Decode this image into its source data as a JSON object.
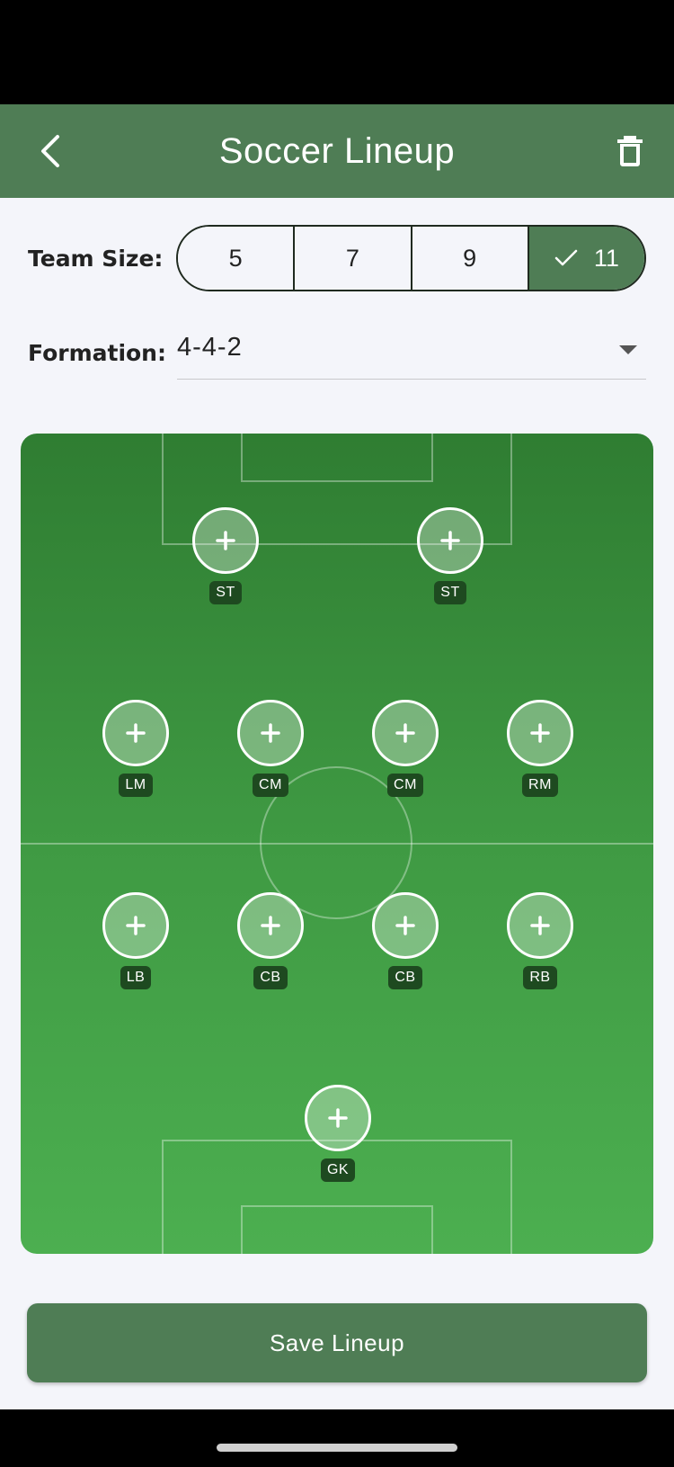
{
  "app": {
    "title": "Soccer Lineup"
  },
  "team_size": {
    "label": "Team Size:",
    "options": [
      "5",
      "7",
      "9",
      "11"
    ],
    "selected": "11"
  },
  "formation": {
    "label": "Formation:",
    "value": "4-4-2"
  },
  "players": [
    {
      "position": "ST"
    },
    {
      "position": "ST"
    },
    {
      "position": "LM"
    },
    {
      "position": "CM"
    },
    {
      "position": "CM"
    },
    {
      "position": "RM"
    },
    {
      "position": "LB"
    },
    {
      "position": "CB"
    },
    {
      "position": "CB"
    },
    {
      "position": "RB"
    },
    {
      "position": "GK"
    }
  ],
  "add_symbol": "+",
  "save_label": "Save Lineup",
  "icons": {
    "back": "chevron-left-icon",
    "delete": "trash-icon",
    "check": "check-icon",
    "dropdown": "caret-down-icon",
    "add": "plus-icon"
  },
  "colors": {
    "primary": "#4f7d55",
    "pitch_top": "#2f7d32",
    "pitch_bottom": "#4caf50",
    "badge": "#1e4a20",
    "background": "#f4f5fa"
  }
}
